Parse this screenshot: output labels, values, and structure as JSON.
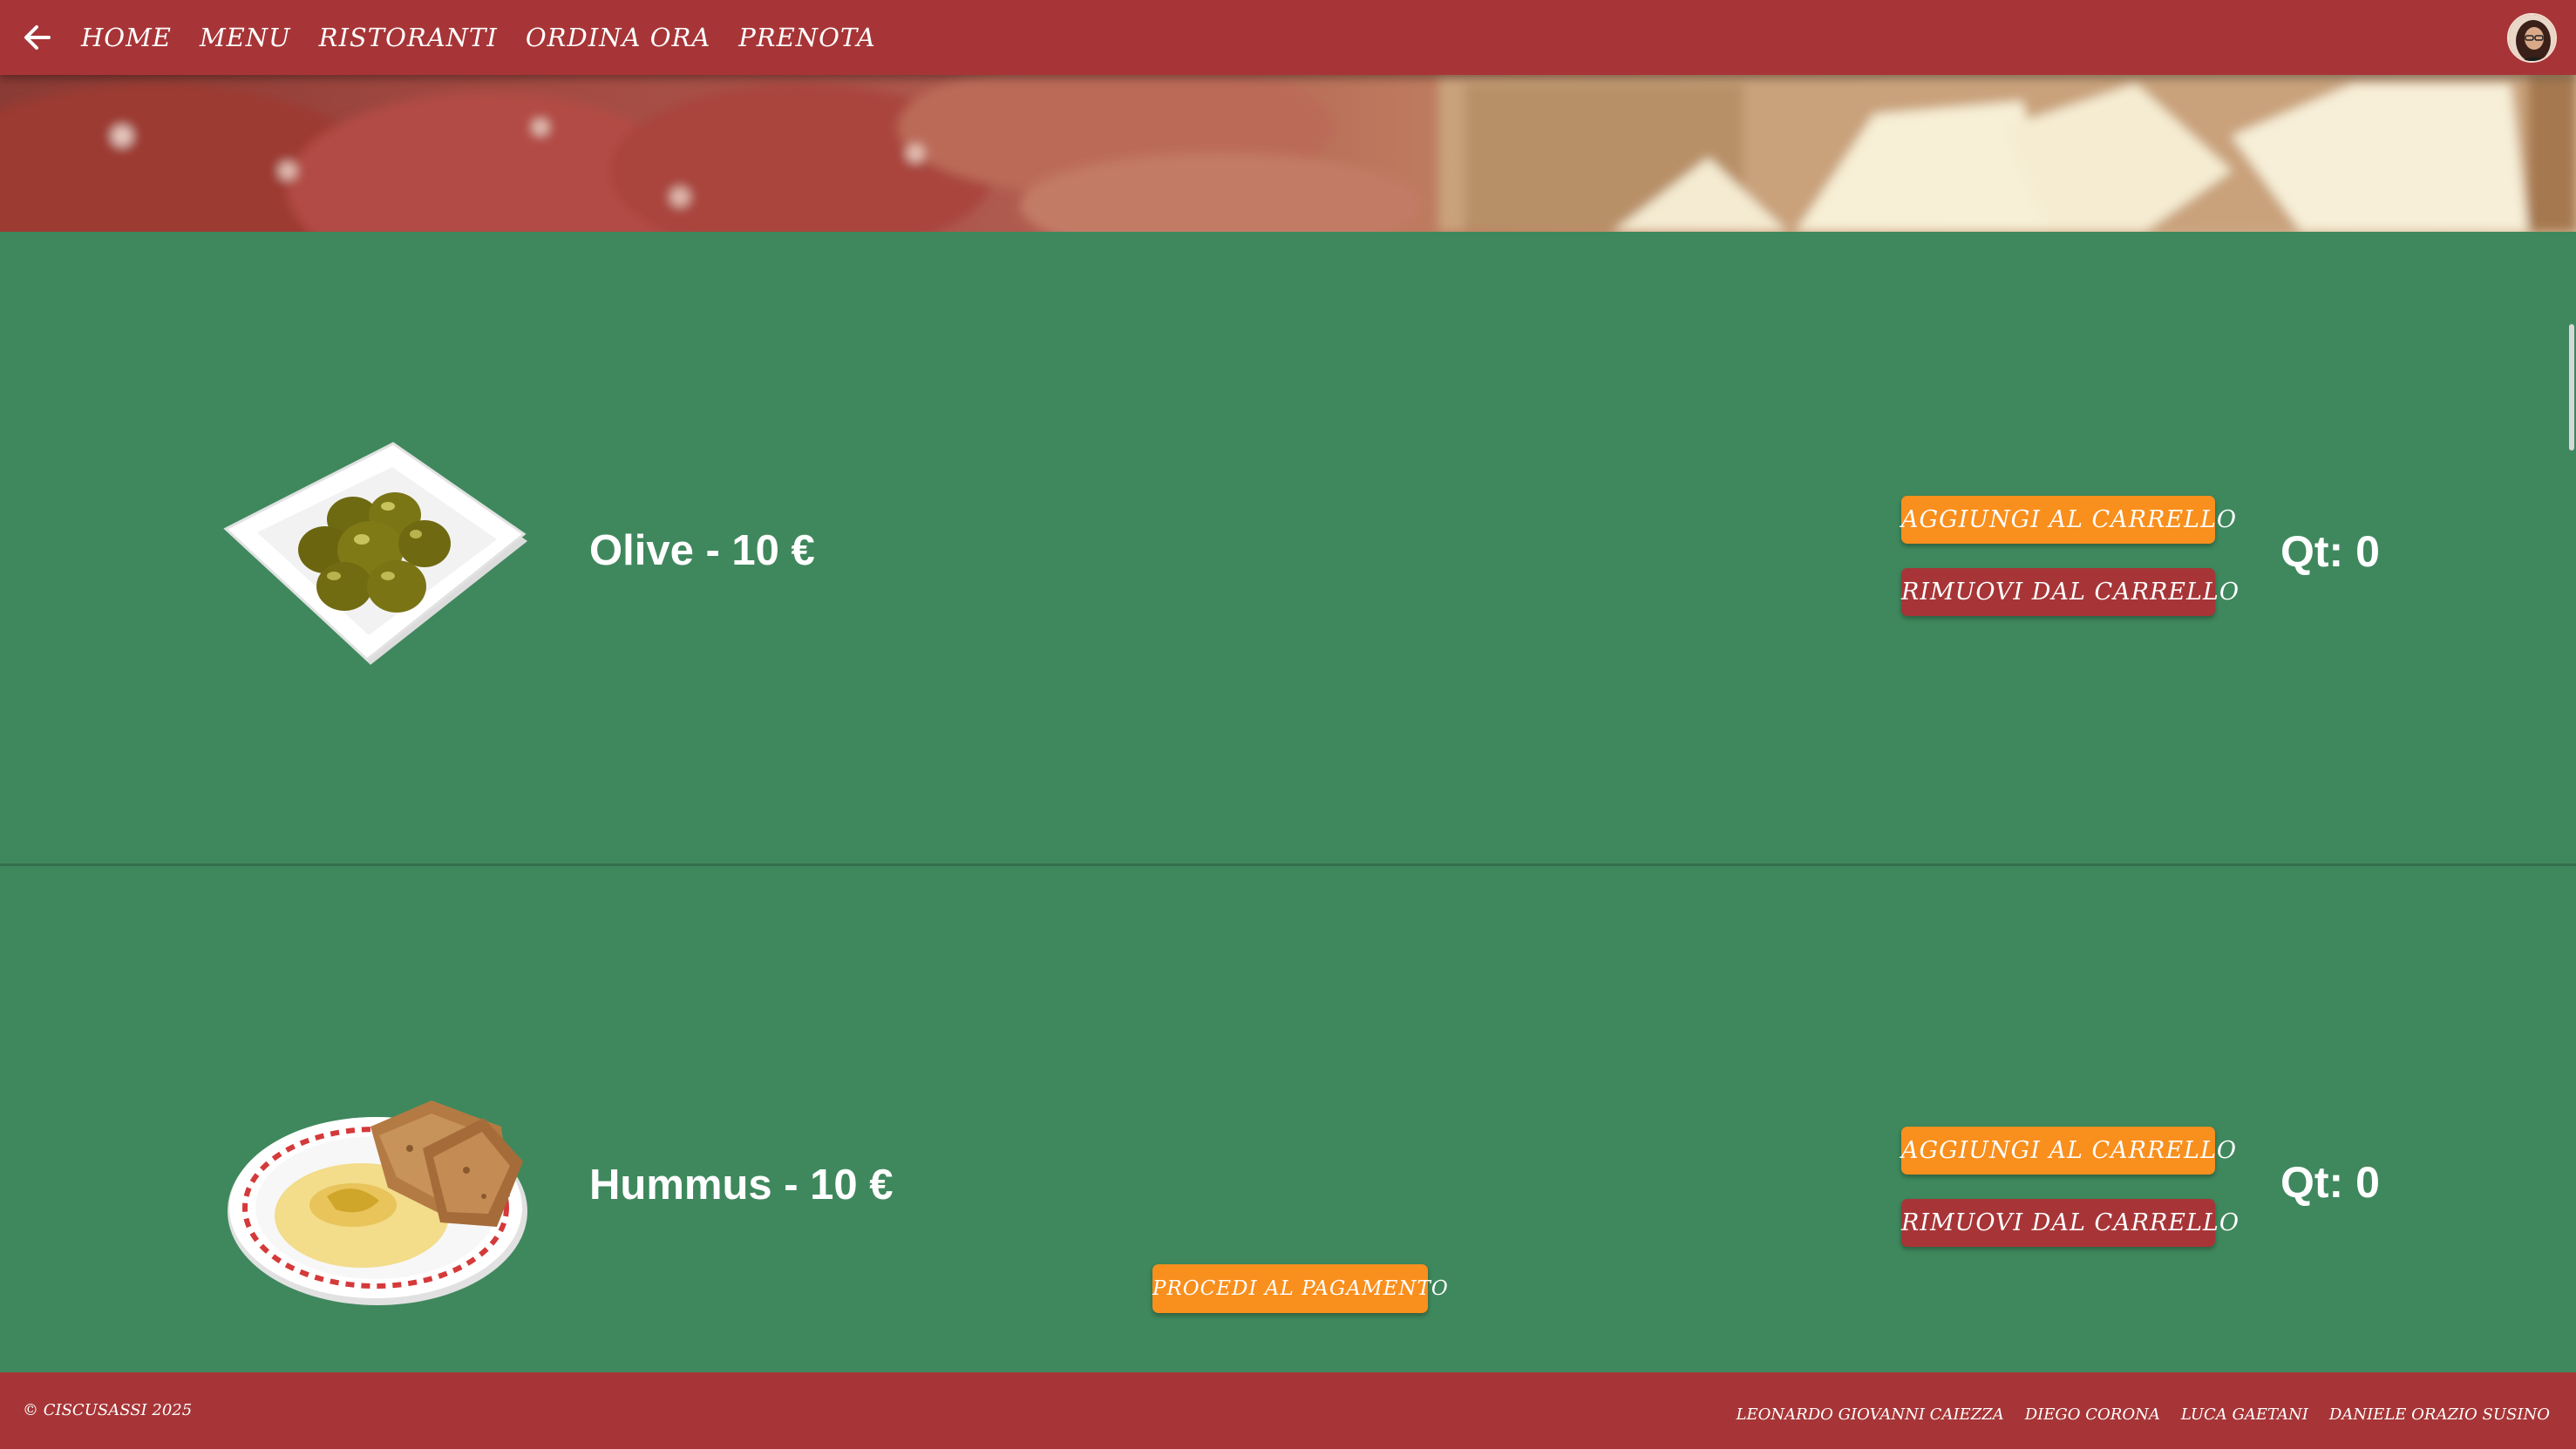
{
  "nav": {
    "back_icon": "arrow-left-icon",
    "links": [
      "HOME",
      "MENU",
      "RISTORANTI",
      "ORDINA ORA",
      "PRENOTA"
    ],
    "avatar_icon": "user-avatar"
  },
  "hero": {
    "image": "salumi-e-formaggi-banner"
  },
  "products": [
    {
      "title": "Olive - 10 €",
      "image": "olive-dish-image",
      "add_label": "AGGIUNGI AL CARRELLO",
      "remove_label": "RIMUOVI DAL CARRELLO",
      "qty_label": "Qt: 0"
    },
    {
      "title": "Hummus - 10 €",
      "image": "hummus-dish-image",
      "add_label": "AGGIUNGI AL CARRELLO",
      "remove_label": "RIMUOVI DAL CARRELLO",
      "qty_label": "Qt: 0"
    }
  ],
  "checkout": {
    "label": "PROCEDI AL PAGAMENTO"
  },
  "footer": {
    "copyright": "© CISCUSASSI 2025",
    "authors": [
      "LEONARDO GIOVANNI CAIEZZA",
      "DIEGO CORONA",
      "LUCA GAETANI",
      "DANIELE ORAZIO SUSINO"
    ]
  },
  "colors": {
    "brand_red": "#a73537",
    "accent_orange": "#f98f1d",
    "background_green": "#3f885d"
  }
}
